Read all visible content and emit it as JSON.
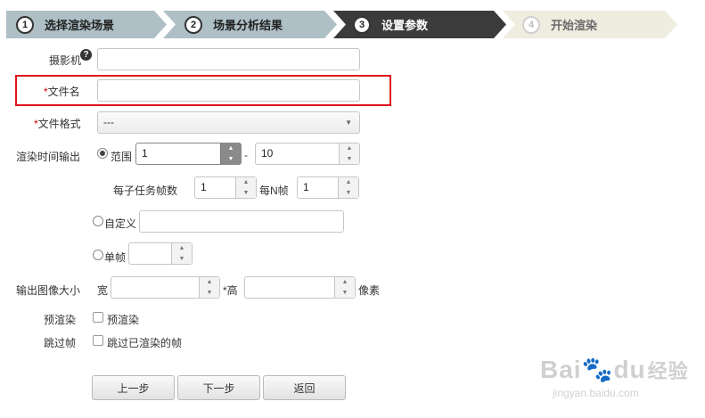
{
  "steps": [
    {
      "num": "1",
      "label": "选择渲染场景"
    },
    {
      "num": "2",
      "label": "场景分析结果"
    },
    {
      "num": "3",
      "label": "设置参数"
    },
    {
      "num": "4",
      "label": "开始渲染"
    }
  ],
  "form": {
    "camera_label": "摄影机",
    "required_mark": "*",
    "filename_label": "文件名",
    "format_label": "文件格式",
    "format_value": "---",
    "render_time_label": "渲染时间输出",
    "range_label": "范围",
    "range_from": "1",
    "range_sep": "-",
    "range_to": "10",
    "frames_per_task_label": "每子任务帧数",
    "frames_per_task_value": "1",
    "every_n_label": "每N帧",
    "every_n_value": "1",
    "custom_label": "自定义",
    "single_label": "单帧",
    "output_size_label": "输出图像大小",
    "width_label": "宽",
    "height_label": "高",
    "height_mark": "*",
    "pixel_label": "像素",
    "prerender_label": "预渲染",
    "prerender_check_label": "预渲染",
    "skip_label": "跳过帧",
    "skip_check_label": "跳过已渲染的帧"
  },
  "buttons": {
    "prev": "上一步",
    "next": "下一步",
    "back": "返回"
  },
  "watermark": {
    "brand": "Bai",
    "brand2": "du",
    "brand_cn": "经验",
    "url": "jingyan.baidu.com"
  },
  "colors": {
    "step_done": "#aebfc6",
    "step_active": "#3b3b3b",
    "step_todo": "#efece0",
    "highlight": "#e0141e",
    "required": "#dd0000"
  }
}
